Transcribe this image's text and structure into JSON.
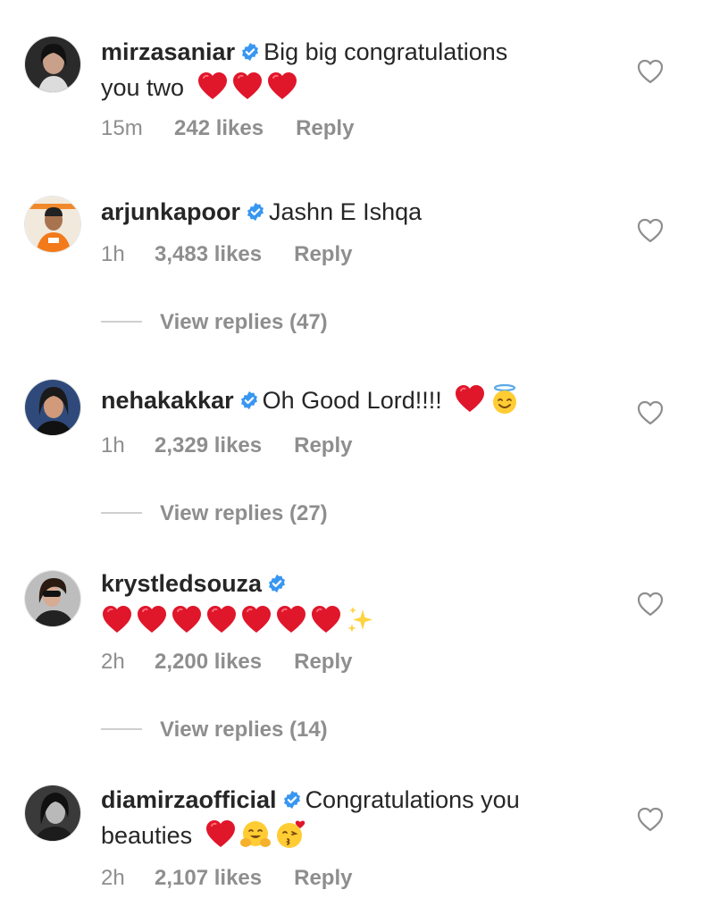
{
  "comments": [
    {
      "username": "mirzasaniar",
      "verified": true,
      "text_line1": "Big big congratulations",
      "text_line2": "you two",
      "emojis": [
        "red-heart",
        "red-heart",
        "red-heart"
      ],
      "time": "15m",
      "likes": "242 likes",
      "reply": "Reply"
    },
    {
      "username": "arjunkapoor",
      "verified": true,
      "text_line1": "Jashn E Ishqa",
      "time": "1h",
      "likes": "3,483 likes",
      "reply": "Reply",
      "view_replies": "View replies (47)"
    },
    {
      "username": "nehakakkar",
      "verified": true,
      "text_line1": "Oh Good Lord!!!!",
      "emojis": [
        "red-heart",
        "halo-smiley"
      ],
      "time": "1h",
      "likes": "2,329 likes",
      "reply": "Reply",
      "view_replies": "View replies (27)"
    },
    {
      "username": "krystledsouza",
      "verified": true,
      "emojis": [
        "red-heart",
        "red-heart",
        "red-heart",
        "red-heart",
        "red-heart",
        "red-heart",
        "red-heart",
        "sparkles"
      ],
      "time": "2h",
      "likes": "2,200 likes",
      "reply": "Reply",
      "view_replies": "View replies (14)"
    },
    {
      "username": "diamirzaofficial",
      "verified": true,
      "text_line1": "Congratulations you",
      "text_line2": "beauties",
      "emojis": [
        "red-heart",
        "hugging-face",
        "kissing-face"
      ],
      "time": "2h",
      "likes": "2,107 likes",
      "reply": "Reply"
    }
  ],
  "colors": {
    "text": "#262626",
    "meta": "#8e8e8e",
    "verified": "#3897f0",
    "heart": "#e0162b"
  }
}
